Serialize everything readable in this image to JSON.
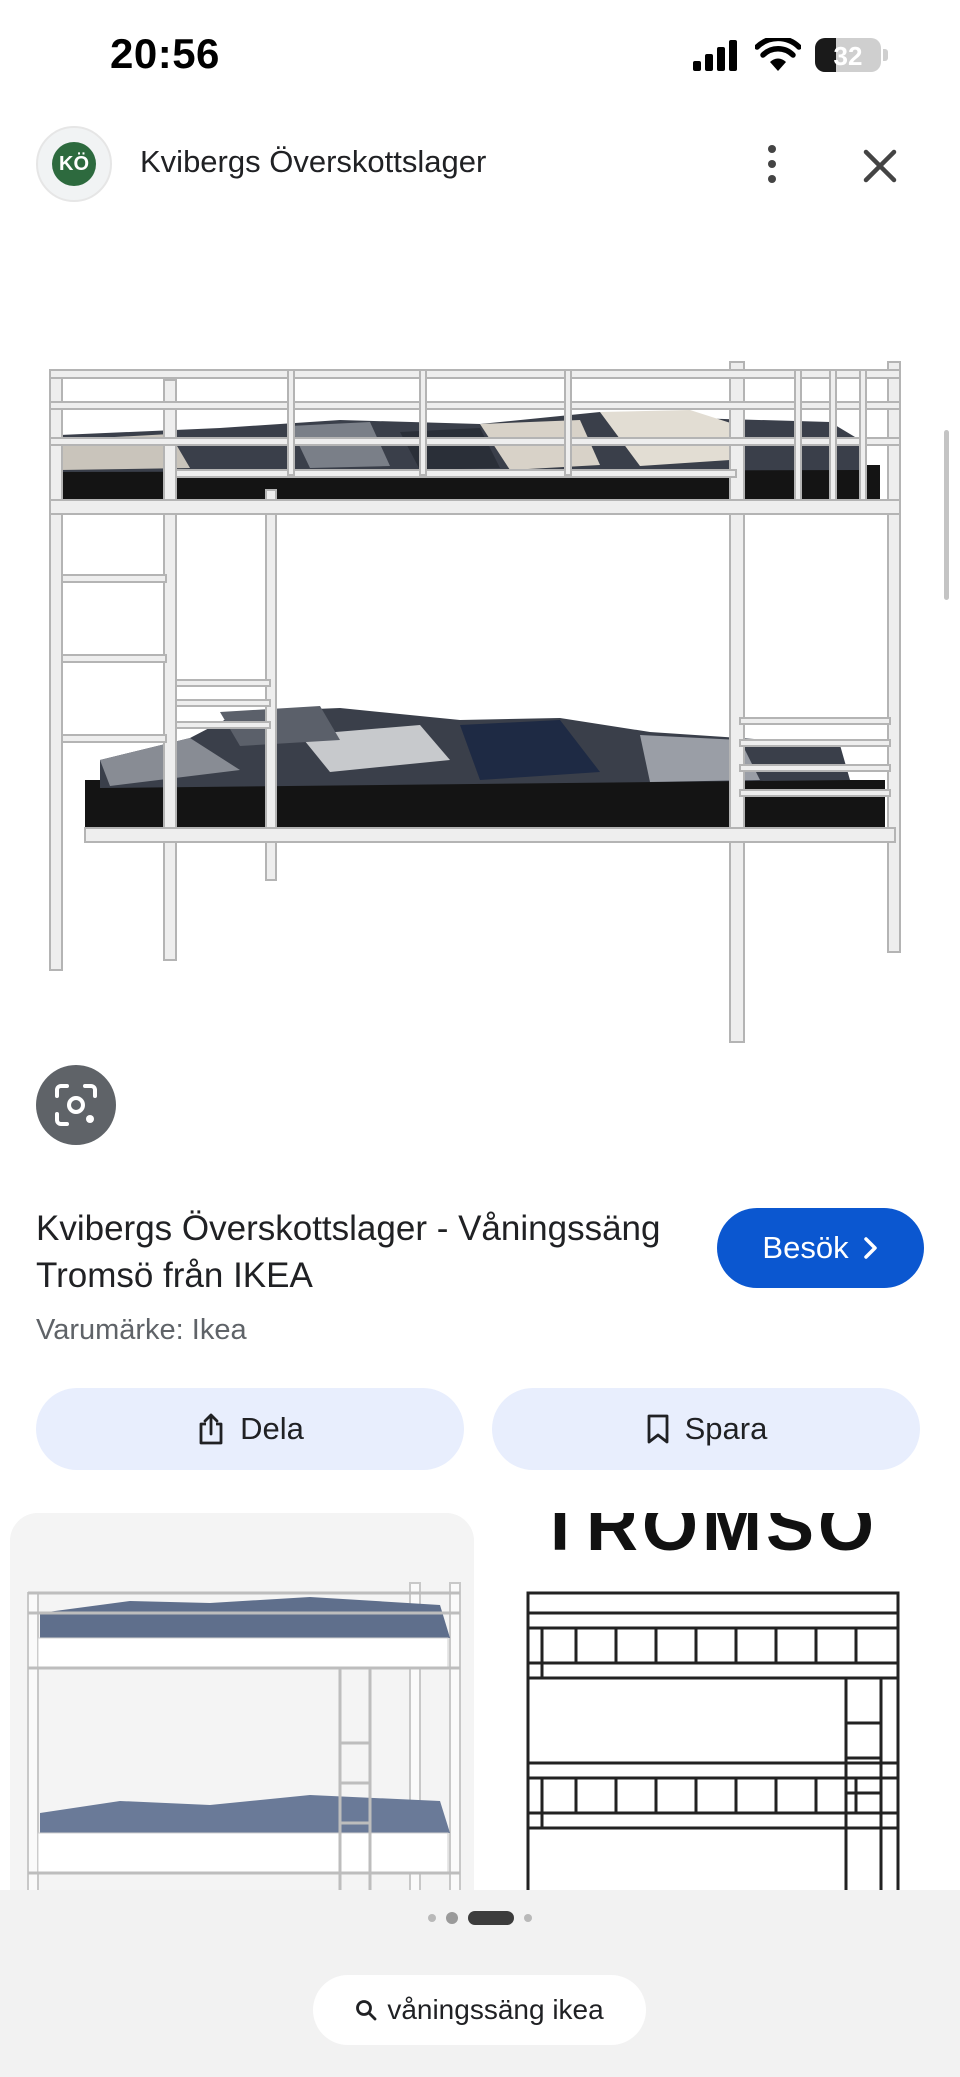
{
  "status_bar": {
    "time": "20:56",
    "battery": "32",
    "battery_level_percent": 32
  },
  "header": {
    "site_logo_text": "KÖ",
    "site_name": "Kvibergs Överskottslager"
  },
  "result": {
    "title": "Kvibergs Överskottslager - Våningssäng Tromsö från IKEA",
    "brand": "Varumärke: Ikea",
    "visit_label": "Besök"
  },
  "actions": {
    "share_label": "Dela",
    "save_label": "Spara"
  },
  "related": {
    "second_image_caption": "TROMSÖ"
  },
  "bottom": {
    "search_query": "våningssäng ikea"
  },
  "icons": {
    "more": "more-vert-icon",
    "close": "close-icon",
    "lens": "lens-icon",
    "visit_chevron": "chevron-right-icon",
    "share": "share-icon",
    "save": "bookmark-icon",
    "search": "search-icon"
  },
  "colors": {
    "accent": "#0b57d0",
    "action_background": "#e8eefd",
    "lens_button": "#5f6368"
  }
}
